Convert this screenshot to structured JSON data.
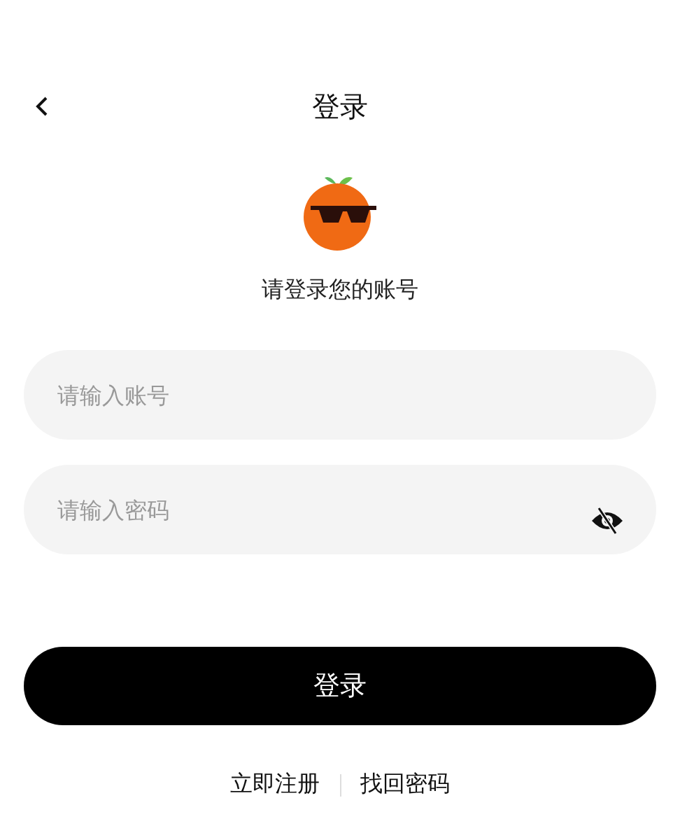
{
  "header": {
    "title": "登录"
  },
  "prompt": "请登录您的账号",
  "account_field": {
    "placeholder": "请输入账号"
  },
  "password_field": {
    "placeholder": "请输入密码",
    "password_visible": false
  },
  "login_button": "登录",
  "links": [
    "立即注册",
    "找回密码"
  ]
}
